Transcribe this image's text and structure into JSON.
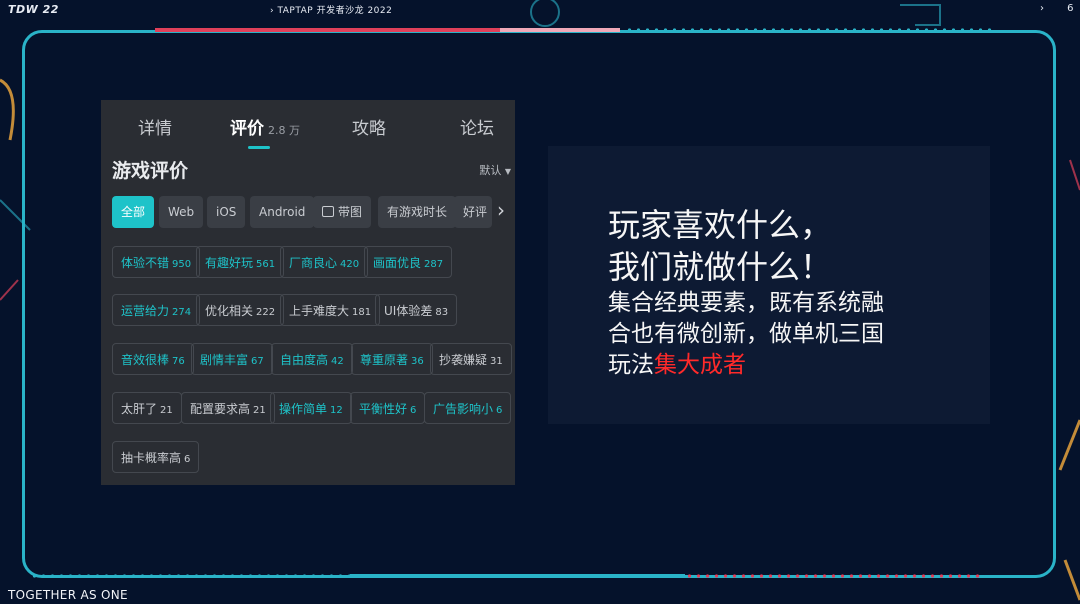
{
  "header": {
    "logo": "TDW 22",
    "event": "TAPTAP 开发者沙龙 2022",
    "page_number": "6",
    "chevron": "›"
  },
  "footer": {
    "text": "TOGETHER AS ONE"
  },
  "colors": {
    "accent": "#1ec3c9",
    "frame": "#2ab3c8",
    "highlight": "#ff2a2a",
    "background": "#05122b"
  },
  "app": {
    "tabs": [
      {
        "label": "详情",
        "count": ""
      },
      {
        "label": "评价",
        "count": "2.8 万"
      },
      {
        "label": "攻略",
        "count": ""
      },
      {
        "label": "论坛",
        "count": ""
      }
    ],
    "section_title": "游戏评价",
    "sort_label": "默认",
    "sort_icon": "caret-down-icon",
    "filters": [
      "全部",
      "Web",
      "iOS",
      "Android",
      "带图",
      "有游戏时长",
      "好评"
    ],
    "filter_image_icon": "image-icon",
    "tags": [
      [
        {
          "label": "体验不错",
          "count": "950",
          "tone": "pos"
        },
        {
          "label": "有趣好玩",
          "count": "561",
          "tone": "pos"
        },
        {
          "label": "厂商良心",
          "count": "420",
          "tone": "pos"
        },
        {
          "label": "画面优良",
          "count": "287",
          "tone": "pos"
        }
      ],
      [
        {
          "label": "运营给力",
          "count": "274",
          "tone": "pos"
        },
        {
          "label": "优化相关",
          "count": "222",
          "tone": "neg"
        },
        {
          "label": "上手难度大",
          "count": "181",
          "tone": "neg"
        },
        {
          "label": "UI体验差",
          "count": "83",
          "tone": "neg"
        }
      ],
      [
        {
          "label": "音效很棒",
          "count": "76",
          "tone": "pos"
        },
        {
          "label": "剧情丰富",
          "count": "67",
          "tone": "pos"
        },
        {
          "label": "自由度高",
          "count": "42",
          "tone": "pos"
        },
        {
          "label": "尊重原著",
          "count": "36",
          "tone": "pos"
        },
        {
          "label": "抄袭嫌疑",
          "count": "31",
          "tone": "neg"
        }
      ],
      [
        {
          "label": "太肝了",
          "count": "21",
          "tone": "neg"
        },
        {
          "label": "配置要求高",
          "count": "21",
          "tone": "neg"
        },
        {
          "label": "操作简单",
          "count": "12",
          "tone": "pos"
        },
        {
          "label": "平衡性好",
          "count": "6",
          "tone": "pos"
        },
        {
          "label": "广告影响小",
          "count": "6",
          "tone": "pos"
        }
      ],
      [
        {
          "label": "抽卡概率高",
          "count": "6",
          "tone": "neg"
        }
      ]
    ]
  },
  "text_panel": {
    "headline_line1": "玩家喜欢什么，",
    "headline_line2": "我们就做什么！",
    "body_line1": "集合经典要素，既有系统融",
    "body_line2": "合也有微创新，做单机三国",
    "body_line3_prefix": "玩法",
    "body_line3_highlight": "集大成者"
  }
}
